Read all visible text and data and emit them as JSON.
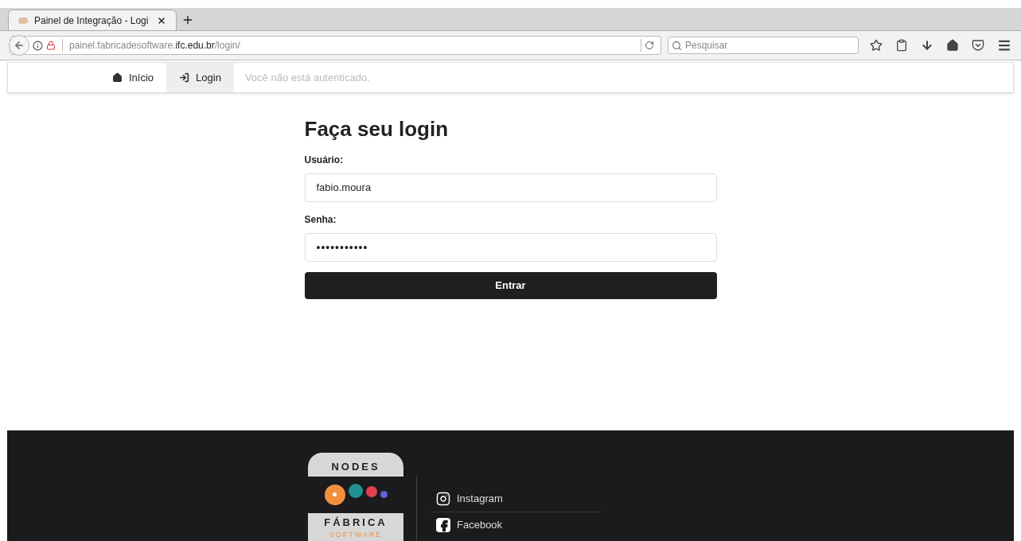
{
  "browser": {
    "tabs": [
      {
        "title": "Painel de Integração - Logi",
        "selected": true
      }
    ],
    "address": {
      "host_prefix": "painel.fabricadesoftware.",
      "host_domain": "ifc.edu.br",
      "path": "/login/"
    },
    "search": {
      "placeholder": "Pesquisar"
    }
  },
  "navbar": {
    "items": [
      {
        "label": "Início",
        "kind": "home",
        "selected": false
      },
      {
        "label": "Login",
        "kind": "login",
        "selected": true
      }
    ],
    "status": "Você não está autenticado."
  },
  "form": {
    "title": "Faça seu login",
    "fields": [
      {
        "label": "Usuário:",
        "value": "fabio.moura",
        "kind": "text"
      },
      {
        "label": "Senha:",
        "value": "•••••••••••",
        "kind": "password"
      }
    ],
    "submit": "Entrar"
  },
  "footer": {
    "logo": {
      "top": "NODES",
      "middle": "FÁBRICA",
      "bottom": "SOFTWARE"
    },
    "links": [
      {
        "label": "Instagram",
        "kind": "instagram"
      },
      {
        "label": "Facebook",
        "kind": "facebook"
      }
    ]
  }
}
